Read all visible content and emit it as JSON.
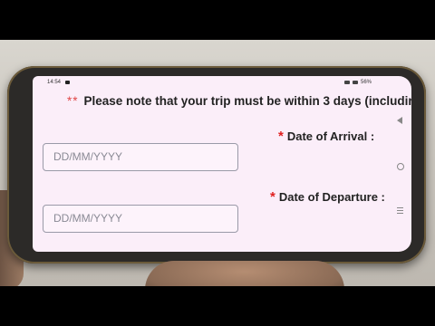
{
  "statusbar": {
    "time": "14:54",
    "battery": "56%"
  },
  "notice": {
    "stars": "**",
    "text": "Please note that your trip must be within 3 days (includir"
  },
  "arrival": {
    "required_mark": "*",
    "label": "Date of Arrival :",
    "placeholder": "DD/MM/YYYY"
  },
  "departure": {
    "required_mark": "*",
    "label": "Date of Departure :",
    "placeholder": "DD/MM/YYYY"
  }
}
